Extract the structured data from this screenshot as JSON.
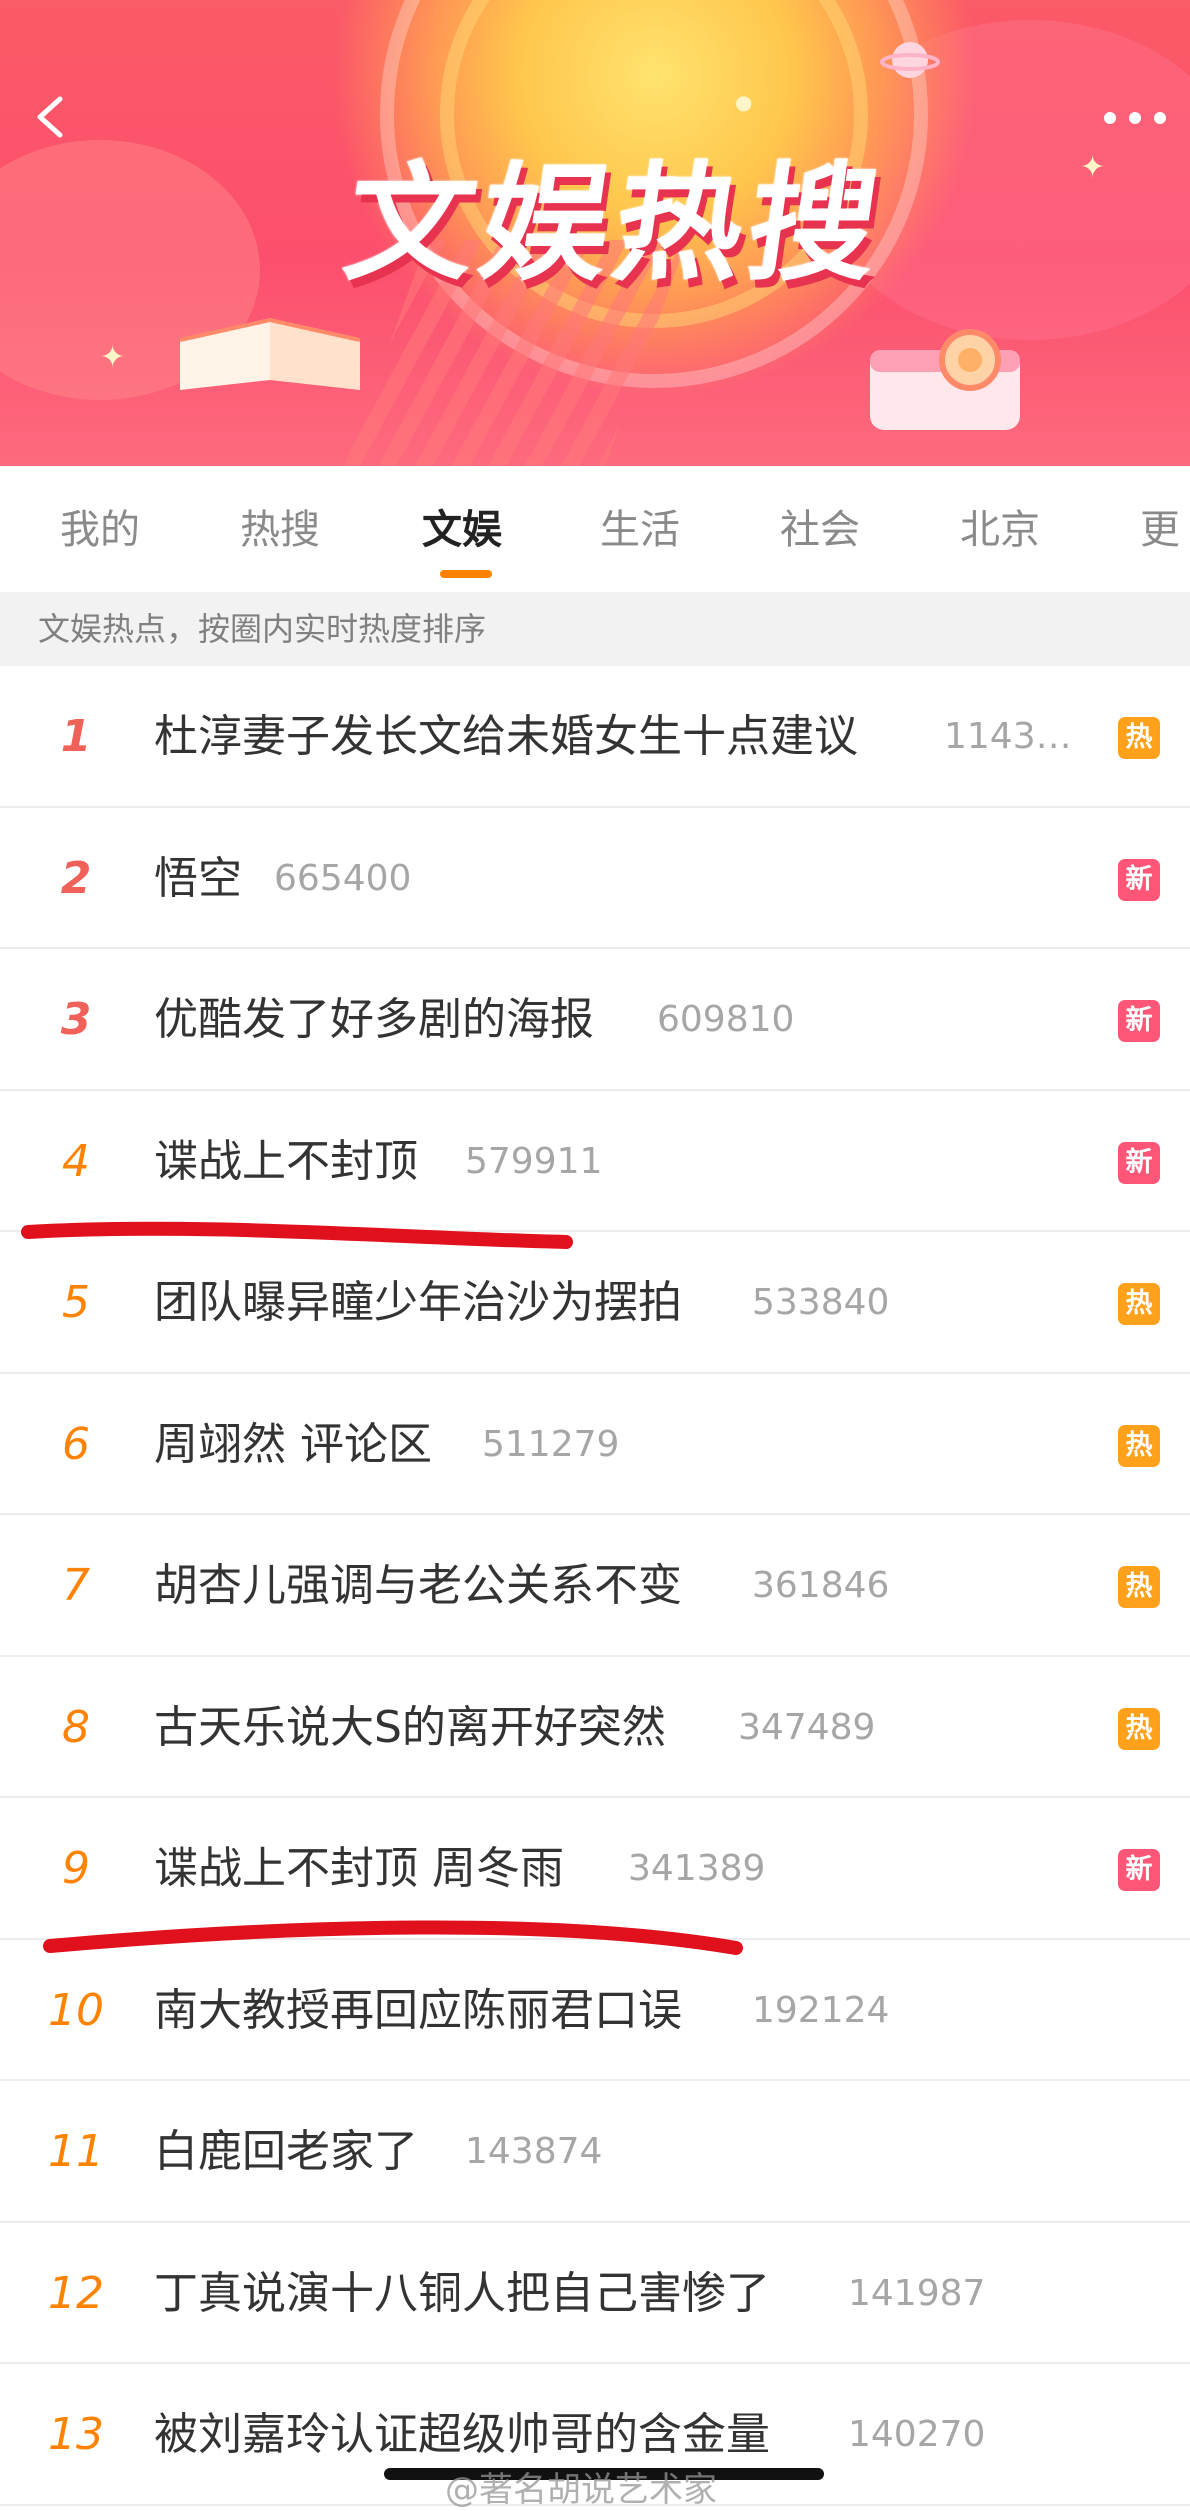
{
  "banner": {
    "title": "文娱热搜",
    "colors": {
      "primary": "#fc4f6d",
      "accent": "#ffc64c"
    }
  },
  "tabs": [
    {
      "label": "我的"
    },
    {
      "label": "热搜"
    },
    {
      "label": "文娱",
      "active": true
    },
    {
      "label": "生活"
    },
    {
      "label": "社会"
    },
    {
      "label": "北京"
    },
    {
      "label": "更"
    }
  ],
  "hint": "文娱热点，按圈内实时热度排序",
  "list": [
    {
      "rank": "1",
      "title": "杜淳妻子发长文给未婚女生十点建议",
      "count": "1143…",
      "badge": "热",
      "badge_type": "hot"
    },
    {
      "rank": "2",
      "title": "悟空",
      "count": "665400",
      "badge": "新",
      "badge_type": "new"
    },
    {
      "rank": "3",
      "title": "优酷发了好多剧的海报",
      "count": "609810",
      "badge": "新",
      "badge_type": "new"
    },
    {
      "rank": "4",
      "title": "谍战上不封顶",
      "count": "579911",
      "badge": "新",
      "badge_type": "new"
    },
    {
      "rank": "5",
      "title": "团队曝异瞳少年治沙为摆拍",
      "count": "533840",
      "badge": "热",
      "badge_type": "hot"
    },
    {
      "rank": "6",
      "title": "周翊然 评论区",
      "count": "511279",
      "badge": "热",
      "badge_type": "hot"
    },
    {
      "rank": "7",
      "title": "胡杏儿强调与老公关系不变",
      "count": "361846",
      "badge": "热",
      "badge_type": "hot"
    },
    {
      "rank": "8",
      "title": "古天乐说大S的离开好突然",
      "count": "347489",
      "badge": "热",
      "badge_type": "hot"
    },
    {
      "rank": "9",
      "title": "谍战上不封顶 周冬雨",
      "count": "341389",
      "badge": "新",
      "badge_type": "new"
    },
    {
      "rank": "10",
      "title": "南大教授再回应陈丽君口误",
      "count": "192124",
      "badge": "",
      "badge_type": ""
    },
    {
      "rank": "11",
      "title": "白鹿回老家了",
      "count": "143874",
      "badge": "",
      "badge_type": ""
    },
    {
      "rank": "12",
      "title": "丁真说演十八铜人把自己害惨了",
      "count": "141987",
      "badge": "",
      "badge_type": ""
    },
    {
      "rank": "13",
      "title": "被刘嘉玲认证超级帅哥的含金量",
      "count": "140270",
      "badge": "",
      "badge_type": ""
    }
  ],
  "watermark": "@著名胡说艺术家",
  "icons": {
    "back": "chevron-left-icon",
    "more": "more-dots-icon"
  },
  "colors": {
    "rank_top": "#f0615a",
    "rank": "#ff8200",
    "hot_badge": "#ffa11a",
    "new_badge": "#fe5677",
    "annotation": "#e0101c"
  }
}
